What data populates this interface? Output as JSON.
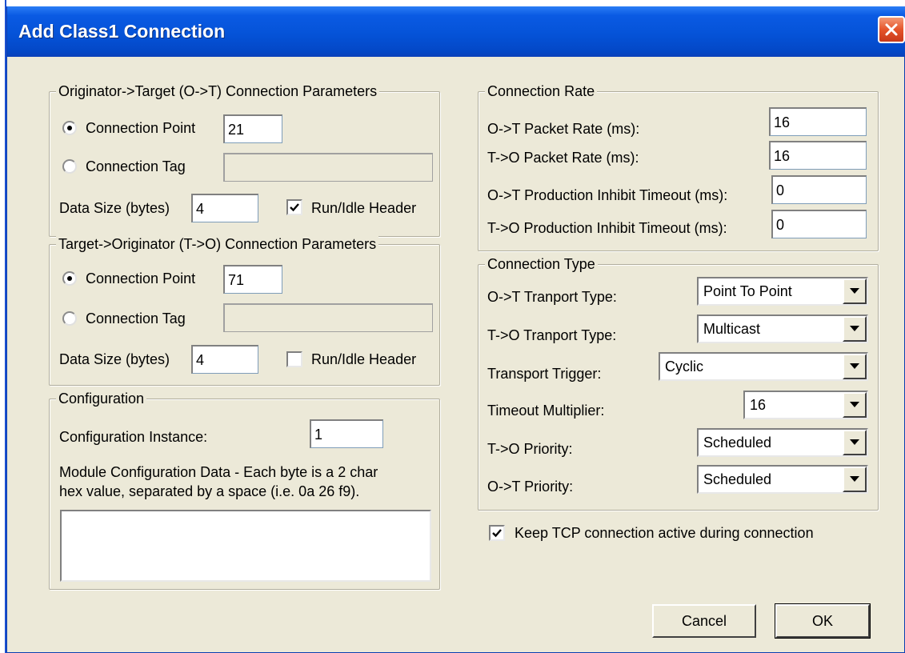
{
  "window": {
    "title": "Add Class1 Connection"
  },
  "ot_group": {
    "legend": "Originator->Target (O->T) Connection Parameters",
    "connection_point_label": "Connection Point",
    "connection_point_value": "21",
    "connection_tag_label": "Connection Tag",
    "connection_tag_value": "",
    "data_size_label": "Data Size (bytes)",
    "data_size_value": "4",
    "run_idle_label": "Run/Idle Header",
    "run_idle_checked": true,
    "selected": "connection_point"
  },
  "to_group": {
    "legend": "Target->Originator (T->O) Connection Parameters",
    "connection_point_label": "Connection Point",
    "connection_point_value": "71",
    "connection_tag_label": "Connection Tag",
    "connection_tag_value": "",
    "data_size_label": "Data Size (bytes)",
    "data_size_value": "4",
    "run_idle_label": "Run/Idle Header",
    "run_idle_checked": false,
    "selected": "connection_point"
  },
  "configuration": {
    "legend": "Configuration",
    "instance_label": "Configuration Instance:",
    "instance_value": "1",
    "data_label_line1": "Module Configuration Data - Each byte is a 2 char",
    "data_label_line2": "hex value, separated by a space (i.e. 0a 26 f9).",
    "data_value": ""
  },
  "connection_rate": {
    "legend": "Connection Rate",
    "ot_packet_label": "O->T Packet Rate (ms):",
    "ot_packet_value": "16",
    "to_packet_label": "T->O Packet Rate (ms):",
    "to_packet_value": "16",
    "ot_inhibit_label": "O->T Production Inhibit Timeout (ms):",
    "ot_inhibit_value": "0",
    "to_inhibit_label": "T->O Production Inhibit Timeout (ms):",
    "to_inhibit_value": "0"
  },
  "connection_type": {
    "legend": "Connection Type",
    "ot_transport_label": "O->T Tranport Type:",
    "ot_transport_value": "Point To Point",
    "to_transport_label": "T->O Tranport Type:",
    "to_transport_value": "Multicast",
    "trigger_label": "Transport Trigger:",
    "trigger_value": "Cyclic",
    "timeout_label": "Timeout Multiplier:",
    "timeout_value": "16",
    "to_priority_label": "T->O Priority:",
    "to_priority_value": "Scheduled",
    "ot_priority_label": "O->T Priority:",
    "ot_priority_value": "Scheduled"
  },
  "keep_tcp": {
    "label": "Keep TCP connection active during connection",
    "checked": true
  },
  "buttons": {
    "cancel": "Cancel",
    "ok": "OK"
  },
  "icons": {
    "close": "close-icon",
    "radio": "radio-dot",
    "check": "checkmark-icon",
    "dropdown": "chevron-down-icon"
  },
  "colors": {
    "titlebar": "#0553d8",
    "dialog_bg": "#ece9d8",
    "close_button": "#e5542a"
  }
}
